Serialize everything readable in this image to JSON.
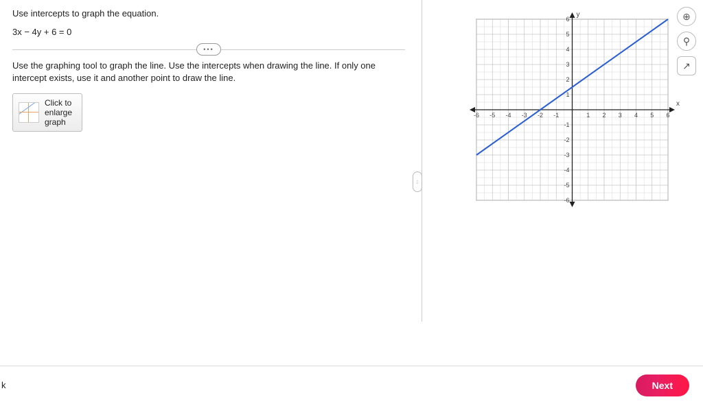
{
  "question": {
    "title": "Use intercepts to graph the equation.",
    "equation": "3x − 4y + 6 = 0",
    "instruction": "Use the graphing tool to graph the line.  Use the intercepts when drawing the line.  If only one intercept exists, use it and another point to draw the line."
  },
  "enlarge_button": {
    "line1": "Click to",
    "line2": "enlarge",
    "line3": "graph"
  },
  "tools": {
    "zoom_in": "⊕",
    "zoom_out": "⚲",
    "popout": "↗"
  },
  "footer": {
    "left_frag": "k",
    "next": "Next"
  },
  "chart_data": {
    "type": "line",
    "title": "",
    "xlabel": "x",
    "ylabel": "y",
    "xlim": [
      -6,
      6
    ],
    "ylim": [
      -6,
      6
    ],
    "x_ticks": [
      -6,
      -5,
      -4,
      -3,
      -2,
      -1,
      1,
      2,
      3,
      4,
      5,
      6
    ],
    "y_ticks": [
      -6,
      -5,
      -4,
      -3,
      -2,
      -1,
      1,
      2,
      3,
      4,
      5,
      6
    ],
    "grid_minor": 0.5,
    "series": [
      {
        "name": "3x − 4y + 6 = 0",
        "color": "#2a5fd6",
        "points": [
          {
            "x": -6,
            "y": -3
          },
          {
            "x": -2,
            "y": 0
          },
          {
            "x": 0,
            "y": 1.5
          },
          {
            "x": 6,
            "y": 6
          }
        ]
      }
    ]
  }
}
